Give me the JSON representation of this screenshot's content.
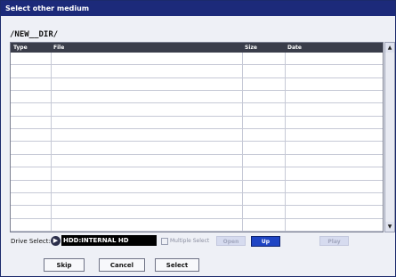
{
  "window": {
    "title": "Select other medium"
  },
  "path": "/NEW__DIR/",
  "table": {
    "columns": [
      "Type",
      "File",
      "Size",
      "Date"
    ],
    "rows": [
      [
        "",
        "",
        "",
        ""
      ],
      [
        "",
        "",
        "",
        ""
      ],
      [
        "",
        "",
        "",
        ""
      ],
      [
        "",
        "",
        "",
        ""
      ],
      [
        "",
        "",
        "",
        ""
      ],
      [
        "",
        "",
        "",
        ""
      ],
      [
        "",
        "",
        "",
        ""
      ],
      [
        "",
        "",
        "",
        ""
      ],
      [
        "",
        "",
        "",
        ""
      ],
      [
        "",
        "",
        "",
        ""
      ],
      [
        "",
        "",
        "",
        ""
      ],
      [
        "",
        "",
        "",
        ""
      ],
      [
        "",
        "",
        "",
        ""
      ],
      [
        "",
        "",
        "",
        ""
      ]
    ]
  },
  "scrollbar": {
    "up_icon": "triangle-up",
    "down_icon": "triangle-down"
  },
  "drive": {
    "label": "Drive Select:",
    "value": "HDD:INTERNAL HD",
    "icon": "drive-select-arrow"
  },
  "controls": {
    "multiple_select_label": "Multiple Select",
    "multiple_select_checked": false,
    "open_label": "Open",
    "up_label": "Up",
    "play_label": "Play"
  },
  "buttons": {
    "skip": "Skip",
    "cancel": "Cancel",
    "select": "Select"
  },
  "colors": {
    "title_bar": "#1c2a7a",
    "header": "#3a3d4a",
    "up_button": "#1f45c4",
    "disabled_button": "#d6dbef",
    "drive_field": "#000000"
  }
}
